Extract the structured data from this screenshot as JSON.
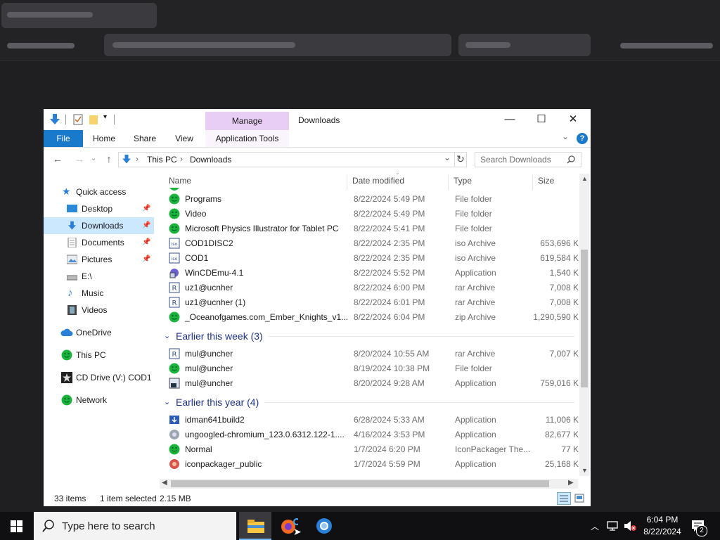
{
  "window": {
    "title": "Downloads",
    "manage_tab": "Manage",
    "minimize": "—",
    "maximize": "☐",
    "close": "✕"
  },
  "ribbon": {
    "tabs": [
      "File",
      "Home",
      "Share",
      "View",
      "Application Tools"
    ],
    "expand": "⌄",
    "help": "?"
  },
  "address": {
    "back": "←",
    "forward": "→",
    "recent": "⌄",
    "up": "↑",
    "crumbs": [
      "This PC",
      "Downloads"
    ],
    "separator": "›",
    "dropdown": "⌄",
    "refresh": "↻",
    "search_placeholder": "Search Downloads"
  },
  "nav": {
    "quick_access": "Quick access",
    "items": [
      {
        "label": "Desktop",
        "icon": "desktop-icon",
        "pinned": true
      },
      {
        "label": "Downloads",
        "icon": "download-arrow-icon",
        "pinned": true
      },
      {
        "label": "Documents",
        "icon": "document-icon",
        "pinned": true
      },
      {
        "label": "Pictures",
        "icon": "pictures-icon",
        "pinned": true
      },
      {
        "label": "E:\\",
        "icon": "drive-icon",
        "pinned": false
      },
      {
        "label": "Music",
        "icon": "music-note-icon",
        "pinned": false
      },
      {
        "label": "Videos",
        "icon": "film-icon",
        "pinned": false
      }
    ],
    "onedrive": "OneDrive",
    "this_pc": "This PC",
    "cd_drive": "CD Drive (V:) COD1",
    "network": "Network",
    "pin_glyph": "📌"
  },
  "columns": {
    "name": "Name",
    "date": "Date modified",
    "type": "Type",
    "size": "Size"
  },
  "groups": [
    {
      "label": "",
      "rows": [
        {
          "name": "Programs",
          "date": "8/22/2024 5:49 PM",
          "type": "File folder",
          "size": "",
          "icon": "green-smiley-icon"
        },
        {
          "name": "Video",
          "date": "8/22/2024 5:49 PM",
          "type": "File folder",
          "size": "",
          "icon": "green-smiley-icon"
        },
        {
          "name": "Microsoft Physics Illustrator for Tablet PC",
          "date": "8/22/2024 5:41 PM",
          "type": "File folder",
          "size": "",
          "icon": "green-smiley-icon"
        },
        {
          "name": "COD1DISC2",
          "date": "8/22/2024 2:35 PM",
          "type": "iso Archive",
          "size": "653,696 K",
          "icon": "iso-icon"
        },
        {
          "name": "COD1",
          "date": "8/22/2024 2:35 PM",
          "type": "iso Archive",
          "size": "619,584 K",
          "icon": "iso-icon"
        },
        {
          "name": "WinCDEmu-4.1",
          "date": "8/22/2024 5:52 PM",
          "type": "Application",
          "size": "1,540 K",
          "icon": "installer-icon"
        },
        {
          "name": "uz1@ucnher",
          "date": "8/22/2024 6:00 PM",
          "type": "rar Archive",
          "size": "7,008 K",
          "icon": "rar-icon"
        },
        {
          "name": "uz1@ucnher (1)",
          "date": "8/22/2024 6:01 PM",
          "type": "rar Archive",
          "size": "7,008 K",
          "icon": "rar-icon"
        },
        {
          "name": "_Oceanofgames.com_Ember_Knights_v1...",
          "date": "8/22/2024 6:04 PM",
          "type": "zip Archive",
          "size": "1,290,590 K",
          "icon": "green-smiley-icon"
        }
      ]
    },
    {
      "label": "Earlier this week (3)",
      "rows": [
        {
          "name": "mul@uncher",
          "date": "8/20/2024 10:55 AM",
          "type": "rar Archive",
          "size": "7,007 K",
          "icon": "rar-icon"
        },
        {
          "name": "mul@uncher",
          "date": "8/19/2024 10:38 PM",
          "type": "File folder",
          "size": "",
          "icon": "green-smiley-icon"
        },
        {
          "name": "mul@uncher",
          "date": "8/20/2024 9:28 AM",
          "type": "Application",
          "size": "759,016 K",
          "icon": "app-exe-icon"
        }
      ]
    },
    {
      "label": "Earlier this year (4)",
      "rows": [
        {
          "name": "idman641build2",
          "date": "6/28/2024 5:33 AM",
          "type": "Application",
          "size": "11,006 K",
          "icon": "idm-icon"
        },
        {
          "name": "ungoogled-chromium_123.0.6312.122-1....",
          "date": "4/16/2024 3:53 PM",
          "type": "Application",
          "size": "82,677 K",
          "icon": "chromium-icon"
        },
        {
          "name": "Normal",
          "date": "1/7/2024 6:20 PM",
          "type": "IconPackager The...",
          "size": "77 K",
          "icon": "green-smiley-icon"
        },
        {
          "name": "iconpackager_public",
          "date": "1/7/2024 5:59 PM",
          "type": "Application",
          "size": "25,168 K",
          "icon": "iconpackager-icon"
        }
      ]
    }
  ],
  "status": {
    "count": "33 items",
    "selected": "1 item selected",
    "size": "2.15 MB"
  },
  "taskbar": {
    "search_placeholder": "Type here to search",
    "time": "6:04 PM",
    "date": "8/22/2024",
    "notifications": "2"
  },
  "colors": {
    "accent": "#1979ca",
    "manage": "#e8cdf5",
    "selection": "#cce8ff",
    "group": "#1e3287",
    "smiley": "#1bb33a"
  }
}
